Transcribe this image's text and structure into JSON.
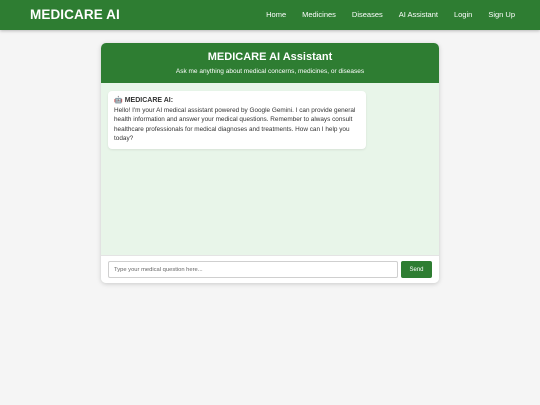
{
  "navbar": {
    "brand": "MEDICARE AI",
    "links": [
      {
        "label": "Home"
      },
      {
        "label": "Medicines"
      },
      {
        "label": "Diseases"
      },
      {
        "label": "AI Assistant"
      },
      {
        "label": "Login"
      },
      {
        "label": "Sign Up"
      }
    ]
  },
  "chat": {
    "title": "MEDICARE AI Assistant",
    "subtitle": "Ask me anything about medical concerns, medicines, or diseases",
    "messages": [
      {
        "sender": "MEDICARE AI:",
        "icon": "robot-icon",
        "text": "Hello! I'm your AI medical assistant powered by Google Gemini. I can provide general health information and answer your medical questions. Remember to always consult healthcare professionals for medical diagnoses and treatments. How can I help you today?"
      }
    ],
    "input": {
      "placeholder": "Type your medical question here...",
      "value": ""
    },
    "send_label": "Send"
  },
  "colors": {
    "brand_green": "#2e7d32",
    "chat_background": "#e8f5e9",
    "page_background": "#f5f5f5"
  }
}
